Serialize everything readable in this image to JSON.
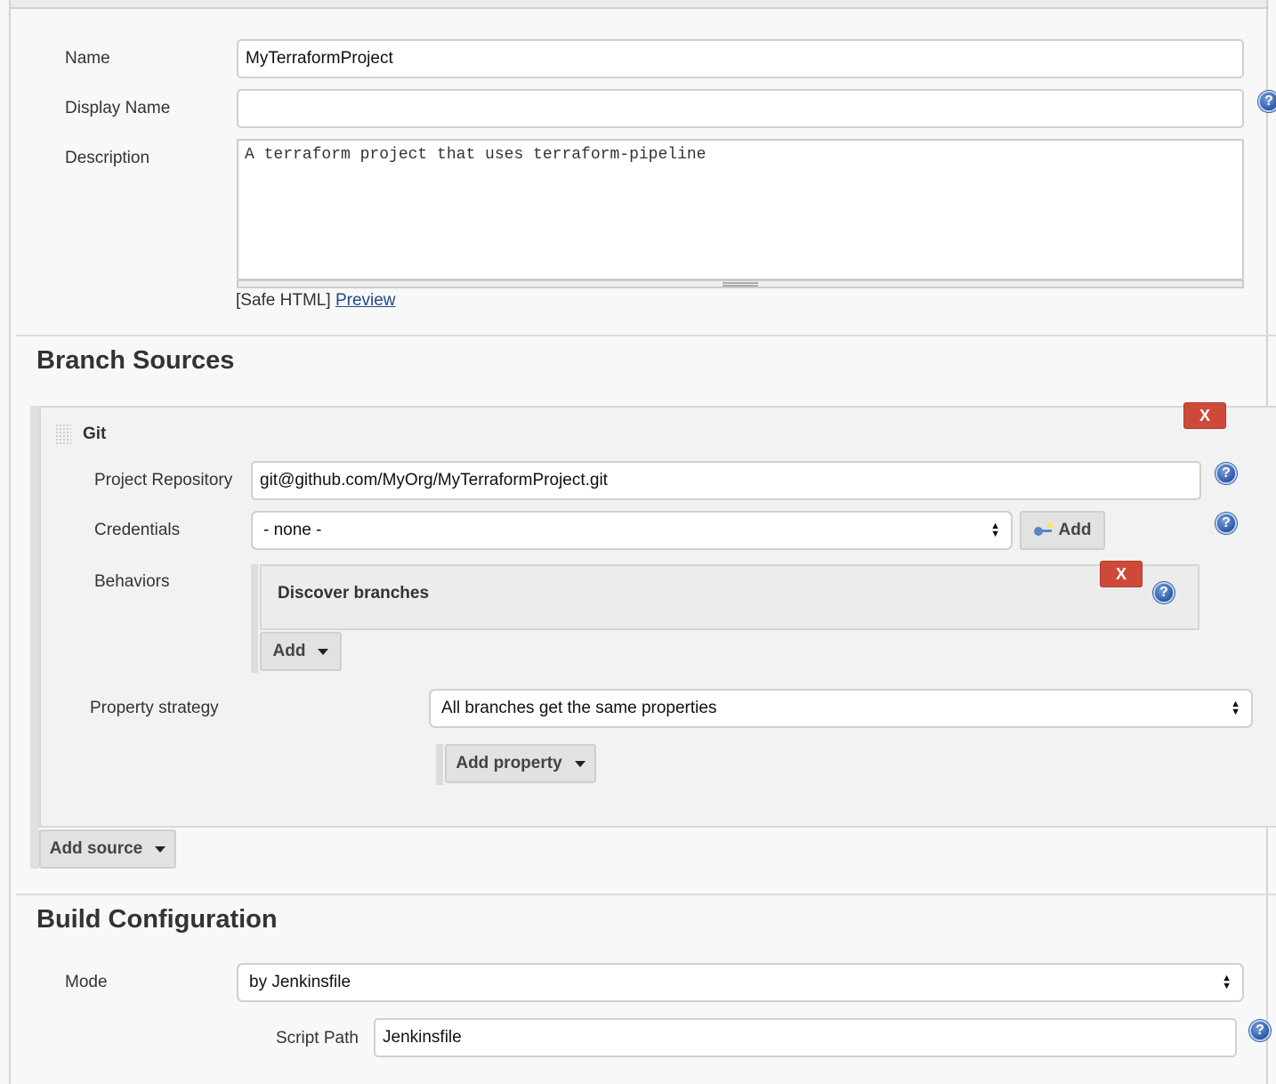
{
  "general": {
    "name_label": "Name",
    "name_value": "MyTerraformProject",
    "display_name_label": "Display Name",
    "display_name_value": "",
    "description_label": "Description",
    "description_value": "A terraform project that uses terraform-pipeline",
    "safe_html_text": "[Safe HTML]",
    "preview_link": "Preview"
  },
  "branch_sources": {
    "heading": "Branch Sources",
    "git": {
      "title": "Git",
      "delete_label": "X",
      "project_repository_label": "Project Repository",
      "project_repository_value": "git@github.com/MyOrg/MyTerraformProject.git",
      "credentials_label": "Credentials",
      "credentials_value": "- none -",
      "credentials_add_label": "Add",
      "behaviors_label": "Behaviors",
      "behaviors": [
        {
          "title": "Discover branches",
          "delete_label": "X"
        }
      ],
      "behaviors_add_label": "Add",
      "property_strategy_label": "Property strategy",
      "property_strategy_value": "All branches get the same properties",
      "add_property_label": "Add property"
    },
    "add_source_label": "Add source"
  },
  "build_configuration": {
    "heading": "Build Configuration",
    "mode_label": "Mode",
    "mode_value": "by Jenkinsfile",
    "script_path_label": "Script Path",
    "script_path_value": "Jenkinsfile"
  },
  "icons": {
    "help": "?",
    "up_arrow": "▲",
    "down_arrow": "▼"
  },
  "colors": {
    "delete_button": "#cd4a3a",
    "help_icon": "#2d5aa6",
    "link": "#204a87"
  }
}
